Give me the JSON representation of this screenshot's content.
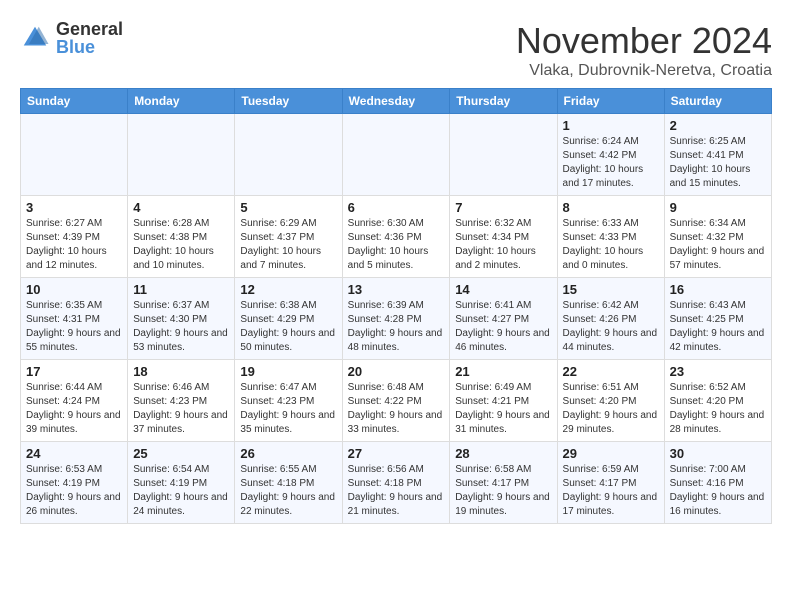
{
  "logo": {
    "general": "General",
    "blue": "Blue"
  },
  "header": {
    "title": "November 2024",
    "subtitle": "Vlaka, Dubrovnik-Neretva, Croatia"
  },
  "weekdays": [
    "Sunday",
    "Monday",
    "Tuesday",
    "Wednesday",
    "Thursday",
    "Friday",
    "Saturday"
  ],
  "weeks": [
    [
      {
        "day": "",
        "info": ""
      },
      {
        "day": "",
        "info": ""
      },
      {
        "day": "",
        "info": ""
      },
      {
        "day": "",
        "info": ""
      },
      {
        "day": "",
        "info": ""
      },
      {
        "day": "1",
        "info": "Sunrise: 6:24 AM\nSunset: 4:42 PM\nDaylight: 10 hours and 17 minutes."
      },
      {
        "day": "2",
        "info": "Sunrise: 6:25 AM\nSunset: 4:41 PM\nDaylight: 10 hours and 15 minutes."
      }
    ],
    [
      {
        "day": "3",
        "info": "Sunrise: 6:27 AM\nSunset: 4:39 PM\nDaylight: 10 hours and 12 minutes."
      },
      {
        "day": "4",
        "info": "Sunrise: 6:28 AM\nSunset: 4:38 PM\nDaylight: 10 hours and 10 minutes."
      },
      {
        "day": "5",
        "info": "Sunrise: 6:29 AM\nSunset: 4:37 PM\nDaylight: 10 hours and 7 minutes."
      },
      {
        "day": "6",
        "info": "Sunrise: 6:30 AM\nSunset: 4:36 PM\nDaylight: 10 hours and 5 minutes."
      },
      {
        "day": "7",
        "info": "Sunrise: 6:32 AM\nSunset: 4:34 PM\nDaylight: 10 hours and 2 minutes."
      },
      {
        "day": "8",
        "info": "Sunrise: 6:33 AM\nSunset: 4:33 PM\nDaylight: 10 hours and 0 minutes."
      },
      {
        "day": "9",
        "info": "Sunrise: 6:34 AM\nSunset: 4:32 PM\nDaylight: 9 hours and 57 minutes."
      }
    ],
    [
      {
        "day": "10",
        "info": "Sunrise: 6:35 AM\nSunset: 4:31 PM\nDaylight: 9 hours and 55 minutes."
      },
      {
        "day": "11",
        "info": "Sunrise: 6:37 AM\nSunset: 4:30 PM\nDaylight: 9 hours and 53 minutes."
      },
      {
        "day": "12",
        "info": "Sunrise: 6:38 AM\nSunset: 4:29 PM\nDaylight: 9 hours and 50 minutes."
      },
      {
        "day": "13",
        "info": "Sunrise: 6:39 AM\nSunset: 4:28 PM\nDaylight: 9 hours and 48 minutes."
      },
      {
        "day": "14",
        "info": "Sunrise: 6:41 AM\nSunset: 4:27 PM\nDaylight: 9 hours and 46 minutes."
      },
      {
        "day": "15",
        "info": "Sunrise: 6:42 AM\nSunset: 4:26 PM\nDaylight: 9 hours and 44 minutes."
      },
      {
        "day": "16",
        "info": "Sunrise: 6:43 AM\nSunset: 4:25 PM\nDaylight: 9 hours and 42 minutes."
      }
    ],
    [
      {
        "day": "17",
        "info": "Sunrise: 6:44 AM\nSunset: 4:24 PM\nDaylight: 9 hours and 39 minutes."
      },
      {
        "day": "18",
        "info": "Sunrise: 6:46 AM\nSunset: 4:23 PM\nDaylight: 9 hours and 37 minutes."
      },
      {
        "day": "19",
        "info": "Sunrise: 6:47 AM\nSunset: 4:23 PM\nDaylight: 9 hours and 35 minutes."
      },
      {
        "day": "20",
        "info": "Sunrise: 6:48 AM\nSunset: 4:22 PM\nDaylight: 9 hours and 33 minutes."
      },
      {
        "day": "21",
        "info": "Sunrise: 6:49 AM\nSunset: 4:21 PM\nDaylight: 9 hours and 31 minutes."
      },
      {
        "day": "22",
        "info": "Sunrise: 6:51 AM\nSunset: 4:20 PM\nDaylight: 9 hours and 29 minutes."
      },
      {
        "day": "23",
        "info": "Sunrise: 6:52 AM\nSunset: 4:20 PM\nDaylight: 9 hours and 28 minutes."
      }
    ],
    [
      {
        "day": "24",
        "info": "Sunrise: 6:53 AM\nSunset: 4:19 PM\nDaylight: 9 hours and 26 minutes."
      },
      {
        "day": "25",
        "info": "Sunrise: 6:54 AM\nSunset: 4:19 PM\nDaylight: 9 hours and 24 minutes."
      },
      {
        "day": "26",
        "info": "Sunrise: 6:55 AM\nSunset: 4:18 PM\nDaylight: 9 hours and 22 minutes."
      },
      {
        "day": "27",
        "info": "Sunrise: 6:56 AM\nSunset: 4:18 PM\nDaylight: 9 hours and 21 minutes."
      },
      {
        "day": "28",
        "info": "Sunrise: 6:58 AM\nSunset: 4:17 PM\nDaylight: 9 hours and 19 minutes."
      },
      {
        "day": "29",
        "info": "Sunrise: 6:59 AM\nSunset: 4:17 PM\nDaylight: 9 hours and 17 minutes."
      },
      {
        "day": "30",
        "info": "Sunrise: 7:00 AM\nSunset: 4:16 PM\nDaylight: 9 hours and 16 minutes."
      }
    ]
  ]
}
